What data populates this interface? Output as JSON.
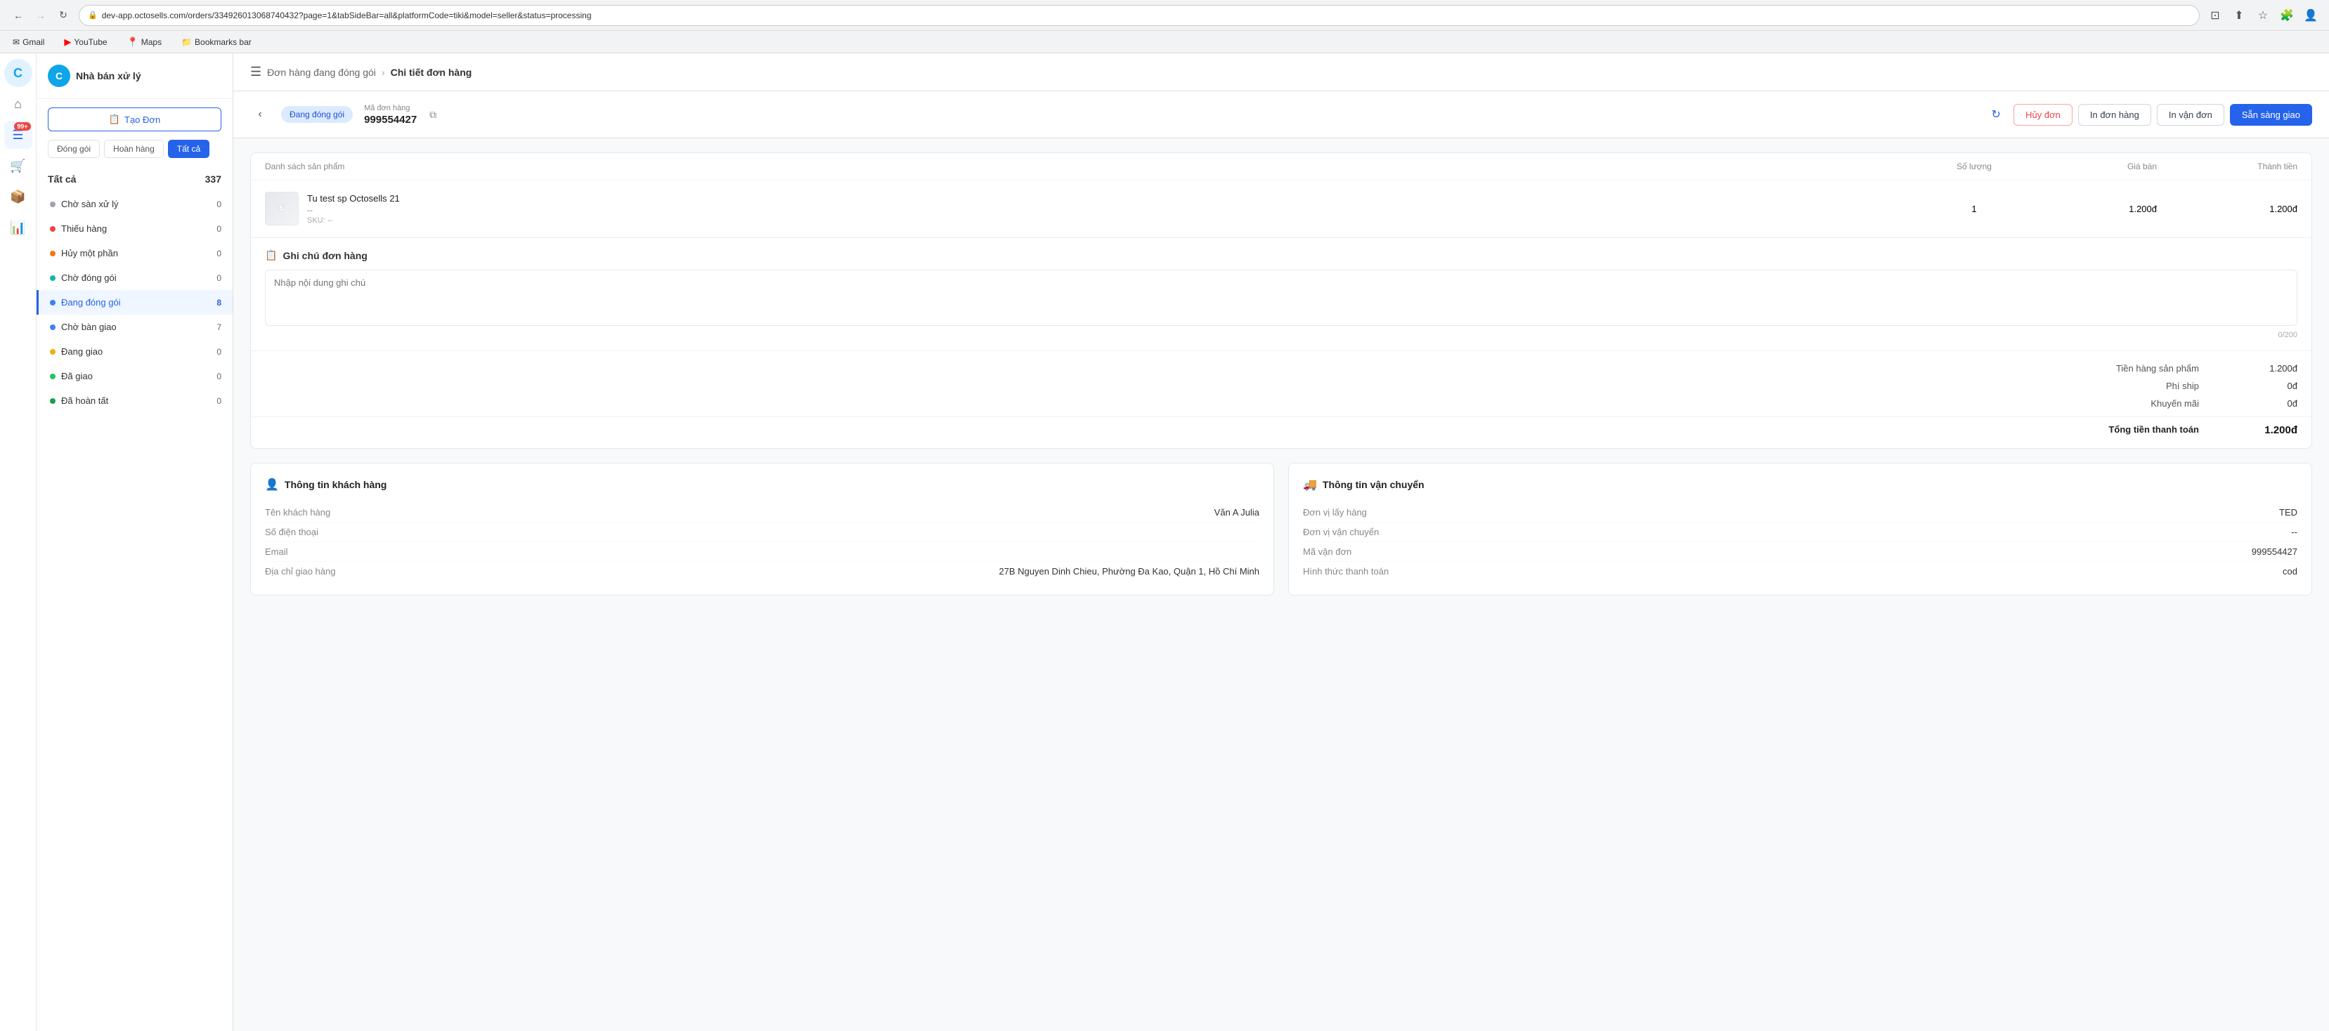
{
  "browser": {
    "url": "dev-app.octosells.com/orders/334926013068740432?page=1&tabSideBar=all&platformCode=tiki&model=seller&status=processing",
    "nav": {
      "back_disabled": false,
      "forward_disabled": true
    }
  },
  "bookmarks": {
    "items": [
      {
        "id": "gmail",
        "label": "Gmail",
        "icon": "✉"
      },
      {
        "id": "youtube",
        "label": "YouTube",
        "icon": "▶"
      },
      {
        "id": "maps",
        "label": "Maps",
        "icon": "📍"
      },
      {
        "id": "bookmarks-bar",
        "label": "Bookmarks bar",
        "icon": "📁"
      }
    ]
  },
  "sidebar": {
    "logo_letter": "C",
    "title": "Nhà bán xử lý",
    "create_order_btn": "Tạo Đơn",
    "filter_tabs": [
      {
        "id": "dong-goi",
        "label": "Đóng gói",
        "active": false
      },
      {
        "id": "hoan-hang",
        "label": "Hoàn hàng",
        "active": false
      },
      {
        "id": "tat-ca",
        "label": "Tất cả",
        "active": true
      }
    ],
    "all_label": "Tất cả",
    "all_count": "337",
    "items": [
      {
        "id": "cho-san-xu-ly",
        "label": "Chờ sàn xử lý",
        "count": "0",
        "dot": "gray"
      },
      {
        "id": "thieu-hang",
        "label": "Thiếu hàng",
        "count": "0",
        "dot": "red"
      },
      {
        "id": "huy-mot-phan",
        "label": "Hủy một phần",
        "count": "0",
        "dot": "orange"
      },
      {
        "id": "cho-dong-goi",
        "label": "Chờ đóng gói",
        "count": "0",
        "dot": "teal"
      },
      {
        "id": "dang-dong-goi",
        "label": "Đang đóng gói",
        "count": "8",
        "dot": "blue",
        "active": true
      },
      {
        "id": "cho-ban-giao",
        "label": "Chờ bàn giao",
        "count": "7",
        "dot": "blue"
      },
      {
        "id": "dang-giao",
        "label": "Đang giao",
        "count": "0",
        "dot": "yellow"
      },
      {
        "id": "da-giao",
        "label": "Đã giao",
        "count": "0",
        "dot": "green"
      },
      {
        "id": "da-hoan-tat",
        "label": "Đã hoàn tất",
        "count": "0",
        "dot": "darkgreen"
      }
    ]
  },
  "icon_sidebar": {
    "icons": [
      {
        "id": "home",
        "symbol": "⌂",
        "active": false,
        "badge": null
      },
      {
        "id": "orders",
        "symbol": "≡",
        "active": true,
        "badge": "99+"
      },
      {
        "id": "cart",
        "symbol": "🛒",
        "active": false,
        "badge": null
      },
      {
        "id": "box",
        "symbol": "📦",
        "active": false,
        "badge": null
      },
      {
        "id": "chart",
        "symbol": "📊",
        "active": false,
        "badge": null
      }
    ]
  },
  "breadcrumb": {
    "parent": "Đơn hàng đang đóng gói",
    "current": "Chi tiết đơn hàng"
  },
  "order": {
    "status_badge": "Đang đóng gói",
    "id_label": "Mã đơn hàng",
    "id_value": "999554427",
    "actions": {
      "cancel": "Hủy đơn",
      "print": "In đơn hàng",
      "print_shipping": "In vận đơn",
      "ready": "Sẵn sàng giao"
    }
  },
  "product_table": {
    "columns": {
      "product": "Danh sách sản phẩm",
      "quantity": "Số lượng",
      "price": "Giá bán",
      "total": "Thành tiền"
    },
    "rows": [
      {
        "name": "Tu test sp Octosells 21",
        "variant": "--",
        "sku": "SKU: --",
        "quantity": "1",
        "price": "1.200đ",
        "total": "1.200đ"
      }
    ]
  },
  "note": {
    "title": "Ghi chú đơn hàng",
    "placeholder": "Nhập nội dung ghi chú",
    "counter": "0/200"
  },
  "summary": {
    "rows": [
      {
        "label": "Tiền hàng sản phẩm",
        "value": "1.200đ"
      },
      {
        "label": "Phí ship",
        "value": "0đ"
      },
      {
        "label": "Khuyến mãi",
        "value": "0đ"
      }
    ],
    "total_label": "Tổng tiền thanh toán",
    "total_value": "1.200đ"
  },
  "customer_info": {
    "title": "Thông tin khách hàng",
    "fields": [
      {
        "label": "Tên khách hàng",
        "value": "Văn A Julia"
      },
      {
        "label": "Số điện thoại",
        "value": ""
      },
      {
        "label": "Email",
        "value": ""
      },
      {
        "label": "Địa chỉ giao hàng",
        "value": "27B Nguyen Dinh Chieu, Phường Đa Kao, Quận 1, Hồ Chí Minh"
      }
    ]
  },
  "shipping_info": {
    "title": "Thông tin vận chuyển",
    "fields": [
      {
        "label": "Đơn vị lấy hàng",
        "value": "TED"
      },
      {
        "label": "Đơn vị vận chuyển",
        "value": "--"
      },
      {
        "label": "Mã vận đơn",
        "value": "999554427"
      },
      {
        "label": "Hình thức thanh toán",
        "value": "cod"
      }
    ]
  }
}
